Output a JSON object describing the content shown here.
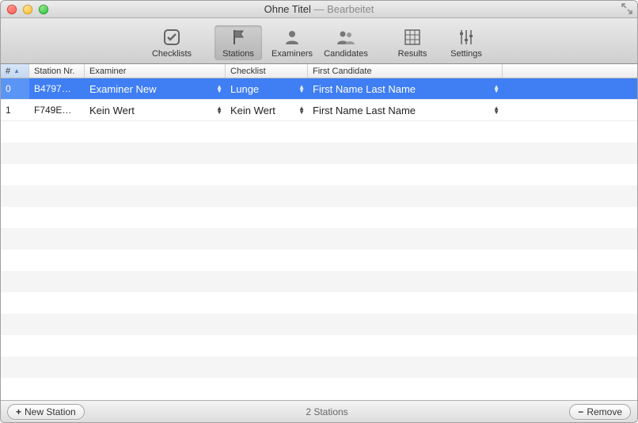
{
  "window": {
    "title": "Ohne Titel",
    "subtitle": "Bearbeitet"
  },
  "toolbar": {
    "items": [
      {
        "id": "checklists",
        "label": "Checklists"
      },
      {
        "id": "stations",
        "label": "Stations",
        "active": true
      },
      {
        "id": "examiners",
        "label": "Examiners"
      },
      {
        "id": "candidates",
        "label": "Candidates"
      },
      {
        "id": "results",
        "label": "Results"
      },
      {
        "id": "settings",
        "label": "Settings"
      }
    ]
  },
  "table": {
    "columns": {
      "number": "#",
      "station_nr": "Station Nr.",
      "examiner": "Examiner",
      "checklist": "Checklist",
      "first_cand": "First Candidate"
    },
    "rows": [
      {
        "num": "0",
        "station_nr": "B4797…",
        "examiner": "Examiner New",
        "checklist": "Lunge",
        "first_candidate": "First Name Last Name",
        "selected": true
      },
      {
        "num": "1",
        "station_nr": "F749E…",
        "examiner": "Kein Wert",
        "checklist": "Kein Wert",
        "first_candidate": "First Name Last Name",
        "selected": false
      }
    ]
  },
  "bottombar": {
    "new_station": "New Station",
    "status": "2 Stations",
    "remove": "Remove"
  }
}
